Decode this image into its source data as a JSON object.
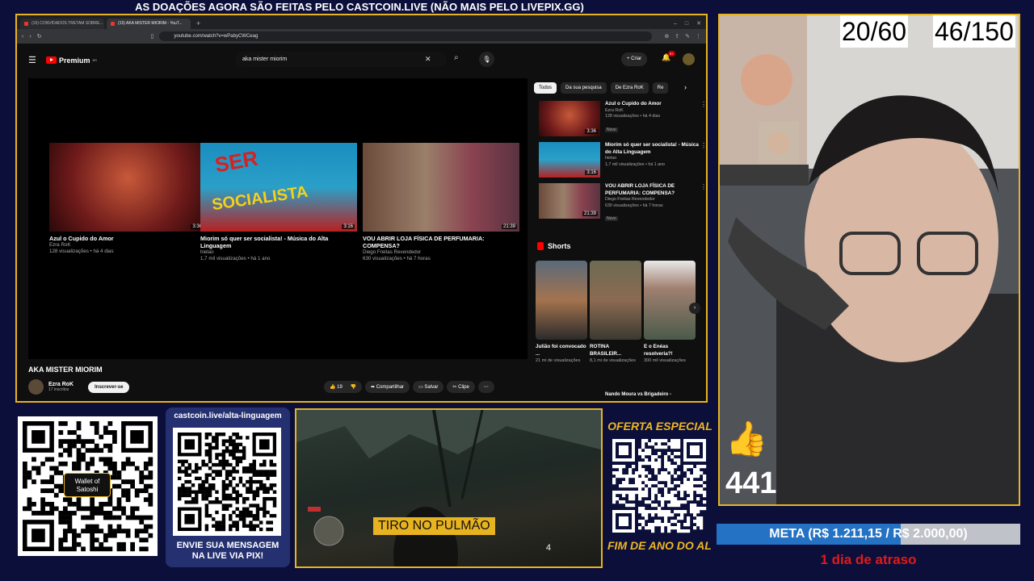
{
  "banner": "AS DOAÇÕES AGORA SÃO FEITAS PELO CASTCOIN.LIVE (NÃO MAIS PELO LIVEPIX.GG)",
  "browser": {
    "tabs": [
      "(15) CONVIDADOS TRETAM SOBRE...",
      "(15) AKA MISTER MIORIM - YouT..."
    ],
    "url": "youtube.com/watch?v=wPabyCWCeag"
  },
  "youtube": {
    "logo": "Premium",
    "search_query": "aka mister miorim",
    "create_label": "Criar",
    "notif_count": "9+",
    "end_cards": [
      {
        "title": "Azul o Cupido do Amor",
        "channel": "Ezra RoK",
        "meta": "128 visualizações • há 4 dias",
        "duration": "3:36"
      },
      {
        "title": "Miorim só quer ser socialista! - Música do Alta Linguagem",
        "channel": "hielao",
        "meta": "1,7 mil visualizações • há 1 ano",
        "duration": "3:16"
      },
      {
        "title": "VOU ABRIR LOJA FÍSICA DE PERFUMARIA: COMPENSA?",
        "channel": "Diego Freitas Revendedor",
        "meta": "630 visualizações • há 7 horas",
        "duration": "21:39"
      }
    ],
    "video_title": "AKA MISTER MIORIM",
    "channel": {
      "name": "Ezra RoK",
      "subs": "17 inscritos",
      "subscribe": "Inscrever-se"
    },
    "actions": {
      "likes": "19",
      "share": "Compartilhar",
      "save": "Salvar",
      "clip": "Clipe"
    },
    "chips": [
      "Todos",
      "Da sua pesquisa",
      "De Ezra RoK",
      "Re"
    ],
    "recommended": [
      {
        "title": "Azul o Cupido do Amor",
        "channel": "Ezra RoK",
        "meta": "128 visualizações • há 4 dias",
        "badge": "Novo",
        "duration": "3:36"
      },
      {
        "title": "Miorim só quer ser socialista! - Música do Alta Linguagem",
        "channel": "hielao",
        "meta": "1,7 mil visualizações • há 1 ano",
        "badge": "",
        "duration": "3:16"
      },
      {
        "title": "VOU ABRIR LOJA FÍSICA DE PERFUMARIA: COMPENSA?",
        "channel": "Diego Freitas Revendedor",
        "meta": "630 visualizações • há 7 horas",
        "badge": "Novo",
        "duration": "21:39"
      }
    ],
    "shorts_label": "Shorts",
    "shorts": [
      {
        "title": "Julião foi convocado ...",
        "meta": "21 mi de visualizações"
      },
      {
        "title": "ROTINA BRASILEIR...",
        "meta": "8,1 mi de visualizações"
      },
      {
        "title": "E o Enéas resolveria?!",
        "meta": "300 mil visualizações"
      }
    ],
    "last_rec": "Nando Moura vs Brigadeiro -"
  },
  "counters": {
    "left": "20/60",
    "right": "46/150"
  },
  "likes": "441",
  "meta": {
    "text": "META (R$ 1.211,15 / R$ 2.000,00)",
    "fraction": 0.6056,
    "delay": "1 dia de atraso"
  },
  "qr": {
    "wallet": "Wallet of Satoshi",
    "pix_url": "castcoin.live/alta-linguagem",
    "pix_caption_1": "ENVIE SUA MENSAGEM",
    "pix_caption_2": "NA LIVE VIA PIX!",
    "oferta": "OFERTA ESPECIAL",
    "fim": "FIM DE ANO DO AL"
  },
  "game": {
    "caption": "TIRO NO PULMÃO",
    "ammo": "4"
  },
  "colors": {
    "accent": "#e7b321",
    "youtube_red": "#ff0000",
    "meta_fill": "#2472c4",
    "atraso": "#e21a1a"
  }
}
